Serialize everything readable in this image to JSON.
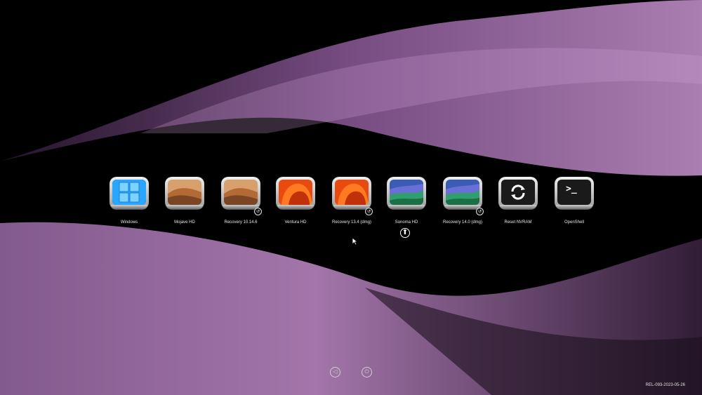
{
  "boot_entries": [
    {
      "id": "windows",
      "label": "Windows",
      "icon": "windows-logo-icon",
      "badge": ""
    },
    {
      "id": "mojave-hd",
      "label": "Mojave HD",
      "icon": "mojave-desert-icon",
      "badge": ""
    },
    {
      "id": "recovery-10146",
      "label": "Recovery 10.14.6",
      "icon": "mojave-desert-icon",
      "badge": "↺"
    },
    {
      "id": "ventura-hd",
      "label": "Ventura HD",
      "icon": "ventura-orange-icon",
      "badge": ""
    },
    {
      "id": "recovery-134",
      "label": "Recovery 13.4 (dmg)",
      "icon": "ventura-orange-icon",
      "badge": "↺"
    },
    {
      "id": "sonoma-hd",
      "label": "Sonoma HD",
      "icon": "sonoma-wave-icon",
      "badge": ""
    },
    {
      "id": "recovery-140",
      "label": "Recovery 14.0 (dmg)",
      "icon": "sonoma-wave-icon",
      "badge": "↺"
    },
    {
      "id": "reset-nvram",
      "label": "Reset NVRAM",
      "icon": "refresh-icon",
      "badge": ""
    },
    {
      "id": "openshell",
      "label": "OpenShell",
      "icon": "terminal-icon",
      "badge": ""
    }
  ],
  "selected_entry": "Sonoma HD",
  "default_indicator": "⬆",
  "controls": {
    "restart_symbol": "◁",
    "shutdown_symbol": "⏻"
  },
  "version": "REL-093-2023-05-26",
  "colors": {
    "background": "#000000",
    "wave": "#b47cc0",
    "label": "#e8e8e8"
  }
}
